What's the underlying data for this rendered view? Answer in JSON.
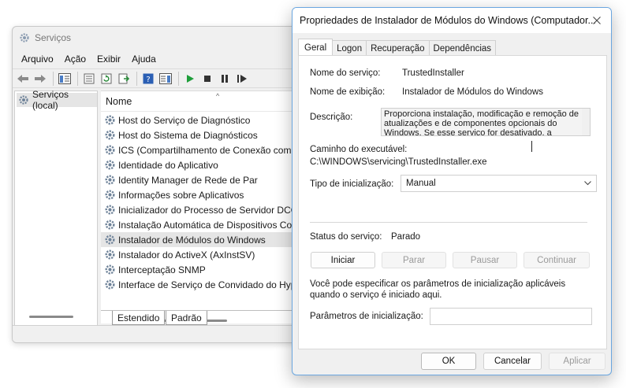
{
  "services_window": {
    "title": "Serviços",
    "menu": [
      "Arquivo",
      "Ação",
      "Exibir",
      "Ajuda"
    ],
    "tree_item": "Serviços (local)",
    "column_header": "Nome",
    "services": [
      "Host do Serviço de Diagnóstico",
      "Host do Sistema de Diagnósticos",
      "ICS (Compartilhamento de Conexão com",
      "Identidade do Aplicativo",
      "Identity Manager de Rede de Par",
      "Informações sobre Aplicativos",
      "Inicializador do Processo de Servidor DCO",
      "Instalação Automática de Dispositivos Co",
      "Instalador de Módulos do Windows",
      "Instalador do ActiveX (AxInstSV)",
      "Interceptação SNMP",
      "Interface de Serviço de Convidado do Hyp"
    ],
    "selected_service_index": 8,
    "bottom_tabs": [
      "Estendido",
      "Padrão"
    ]
  },
  "dialog": {
    "title": "Propriedades de Instalador de Módulos do Windows (Computador...",
    "tabs": [
      "Geral",
      "Logon",
      "Recuperação",
      "Dependências"
    ],
    "active_tab": "Geral",
    "service_name_label": "Nome do serviço:",
    "service_name_value": "TrustedInstaller",
    "display_name_label": "Nome de exibição:",
    "display_name_value": "Instalador de Módulos do Windows",
    "description_label": "Descrição:",
    "description_value": "Proporciona instalação, modificação e remoção de atualizações e de componentes opcionais do Windows. Se esse serviço for desativado, a",
    "exec_path_label": "Caminho do executável:",
    "exec_path_value": "C:\\WINDOWS\\servicing\\TrustedInstaller.exe",
    "startup_type_label": "Tipo de inicialização:",
    "startup_type_value": "Manual",
    "status_label": "Status do serviço:",
    "status_value": "Parado",
    "buttons": {
      "start": "Iniciar",
      "stop": "Parar",
      "pause": "Pausar",
      "resume": "Continuar"
    },
    "hint_text": "Você pode especificar os parâmetros de inicialização aplicáveis quando o serviço é iniciado aqui.",
    "start_params_label": "Parâmetros de inicialização:",
    "start_params_value": "",
    "footer": {
      "ok": "OK",
      "cancel": "Cancelar",
      "apply": "Aplicar"
    }
  },
  "colors": {
    "dialog_border": "#6aa6e0",
    "selection": "#e5e5e5",
    "play_green": "#1e9e3a"
  },
  "icons": {
    "service": "gear-icon",
    "close": "close-icon",
    "dropdown": "chevron-down-icon"
  }
}
